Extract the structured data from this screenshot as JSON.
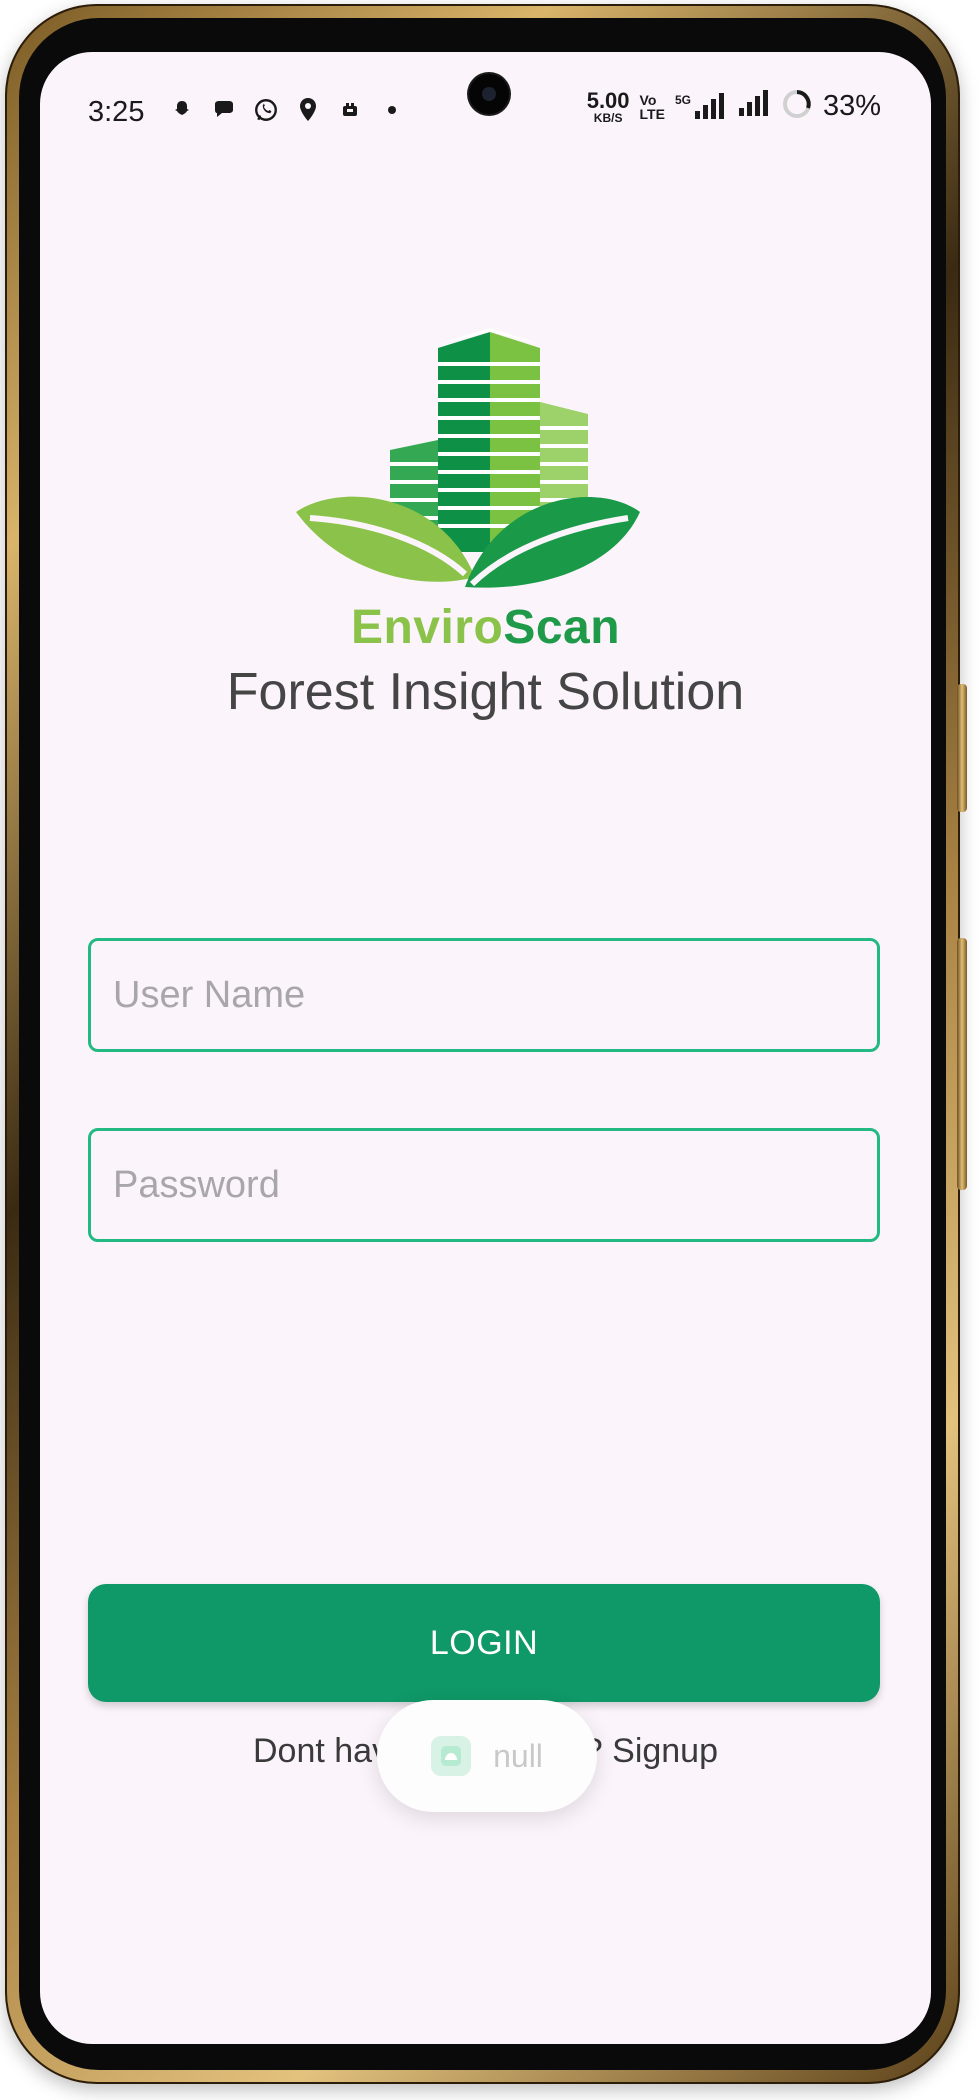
{
  "status_bar": {
    "time": "3:25",
    "net_speed_value": "5.00",
    "net_speed_unit": "KB/S",
    "volte_top": "Vo",
    "volte_bottom": "LTE",
    "network_type": "5G",
    "battery_percent": "33%",
    "notification_icons": [
      "snapchat-icon",
      "chat-bubble-icon",
      "whatsapp-icon",
      "maps-pin-icon",
      "app-icon",
      "dot-icon"
    ]
  },
  "brand": {
    "name_part1": "Enviro",
    "name_part2": "Scan",
    "tagline": "Forest Insight Solution",
    "colors": {
      "light_green": "#8bc34a",
      "dark_green": "#1f9a49"
    }
  },
  "form": {
    "username_placeholder": "User Name",
    "username_value": "",
    "password_placeholder": "Password",
    "password_value": "",
    "login_label": "LOGIN",
    "signup_prefix": "Dont have an account",
    "signup_link": "? Signup",
    "accent_color": "#23b983",
    "button_color": "#0f9868"
  },
  "toast": {
    "text": "null"
  }
}
